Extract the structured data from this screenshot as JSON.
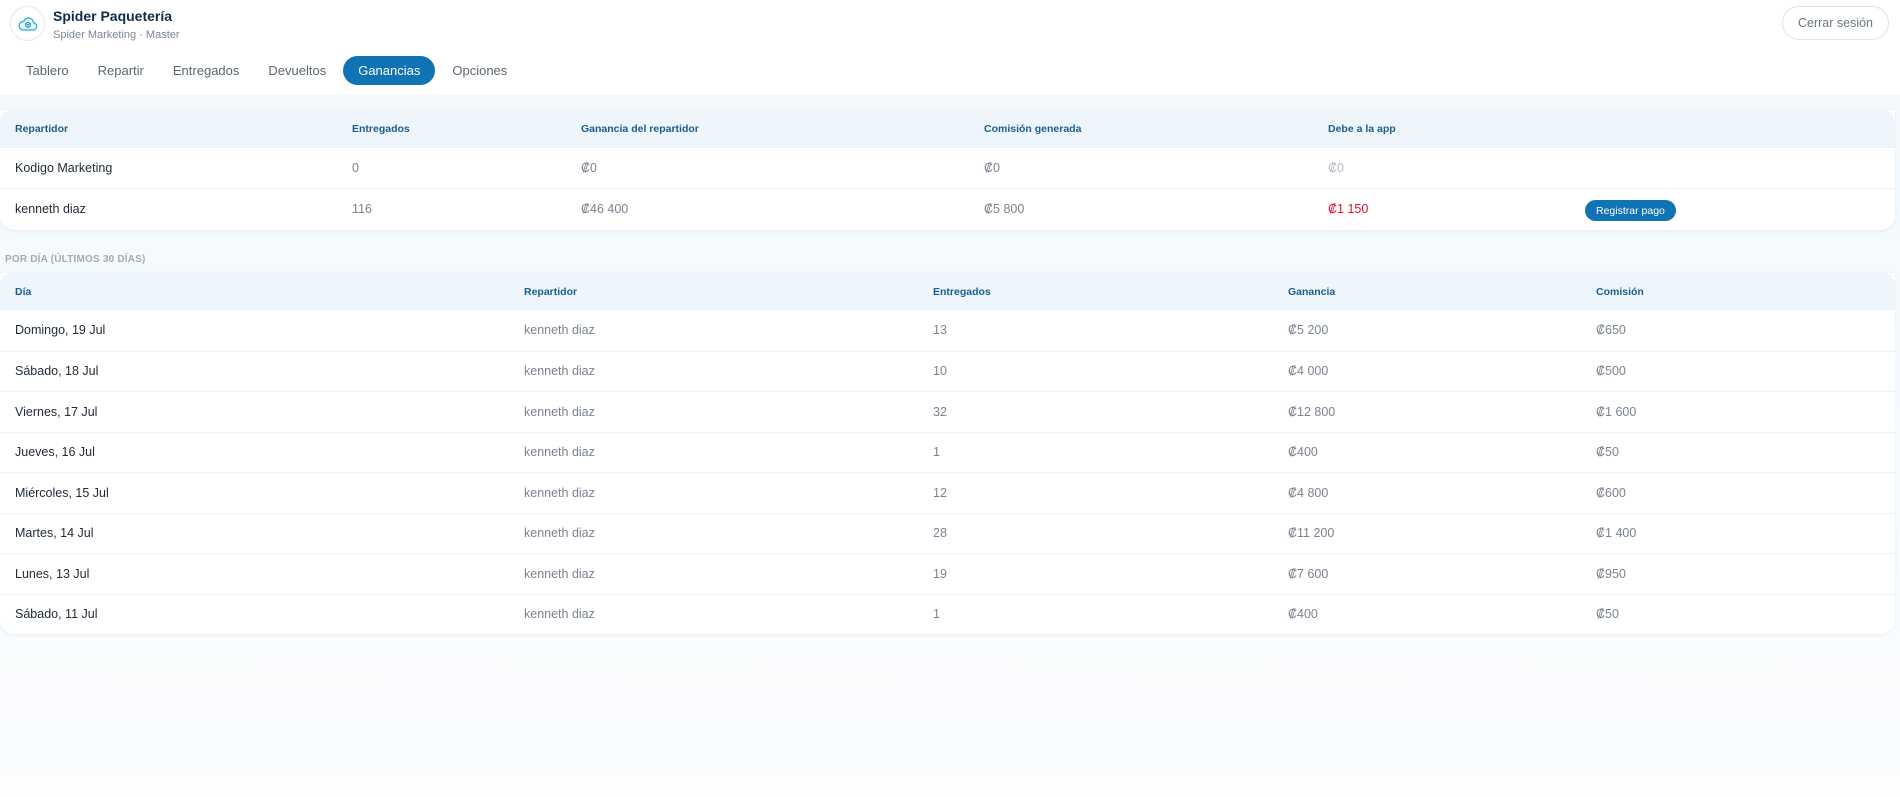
{
  "app": {
    "title": "Spider Paquetería",
    "subtitle": "Spider Marketing · Master",
    "logout_label": "Cerrar sesión"
  },
  "tabs": [
    {
      "label": "Tablero",
      "active": false
    },
    {
      "label": "Repartir",
      "active": false
    },
    {
      "label": "Entregados",
      "active": false
    },
    {
      "label": "Devueltos",
      "active": false
    },
    {
      "label": "Ganancias",
      "active": true
    },
    {
      "label": "Opciones",
      "active": false
    }
  ],
  "summary": {
    "headers": [
      "Repartidor",
      "Entregados",
      "Ganancia del repartidor",
      "Comisión generada",
      "Debe a la app"
    ],
    "rows": [
      {
        "name": "Kodigo Marketing",
        "delivered": "0",
        "earnings": "₡0",
        "commission": "₡0",
        "owes": "₡0",
        "owes_status": "none",
        "action": ""
      },
      {
        "name": "kenneth diaz",
        "delivered": "116",
        "earnings": "₡46 400",
        "commission": "₡5 800",
        "owes": "₡1 150",
        "owes_status": "due",
        "action": "Registrar pago"
      }
    ]
  },
  "daily": {
    "section_label": "POR DÍA (ÚLTIMOS 30 DÍAS)",
    "headers": [
      "Día",
      "Repartidor",
      "Entregados",
      "Ganancia",
      "Comisión"
    ],
    "rows": [
      {
        "day": "Domingo, 19 Jul",
        "courier": "kenneth diaz",
        "delivered": "13",
        "earnings": "₡5 200",
        "commission": "₡650"
      },
      {
        "day": "Sábado, 18 Jul",
        "courier": "kenneth diaz",
        "delivered": "10",
        "earnings": "₡4 000",
        "commission": "₡500"
      },
      {
        "day": "Viernes, 17 Jul",
        "courier": "kenneth diaz",
        "delivered": "32",
        "earnings": "₡12 800",
        "commission": "₡1 600"
      },
      {
        "day": "Jueves, 16 Jul",
        "courier": "kenneth diaz",
        "delivered": "1",
        "earnings": "₡400",
        "commission": "₡50"
      },
      {
        "day": "Miércoles, 15 Jul",
        "courier": "kenneth diaz",
        "delivered": "12",
        "earnings": "₡4 800",
        "commission": "₡600"
      },
      {
        "day": "Martes, 14 Jul",
        "courier": "kenneth diaz",
        "delivered": "28",
        "earnings": "₡11 200",
        "commission": "₡1 400"
      },
      {
        "day": "Lunes, 13 Jul",
        "courier": "kenneth diaz",
        "delivered": "19",
        "earnings": "₡7 600",
        "commission": "₡950"
      },
      {
        "day": "Sábado, 11 Jul",
        "courier": "kenneth diaz",
        "delivered": "1",
        "earnings": "₡400",
        "commission": "₡50"
      }
    ]
  },
  "colors": {
    "accent": "#0f73b4",
    "header_text": "#1a5e8e",
    "due": "#e3102b"
  },
  "icons": {
    "logo": "cloud-box-logo-icon"
  }
}
